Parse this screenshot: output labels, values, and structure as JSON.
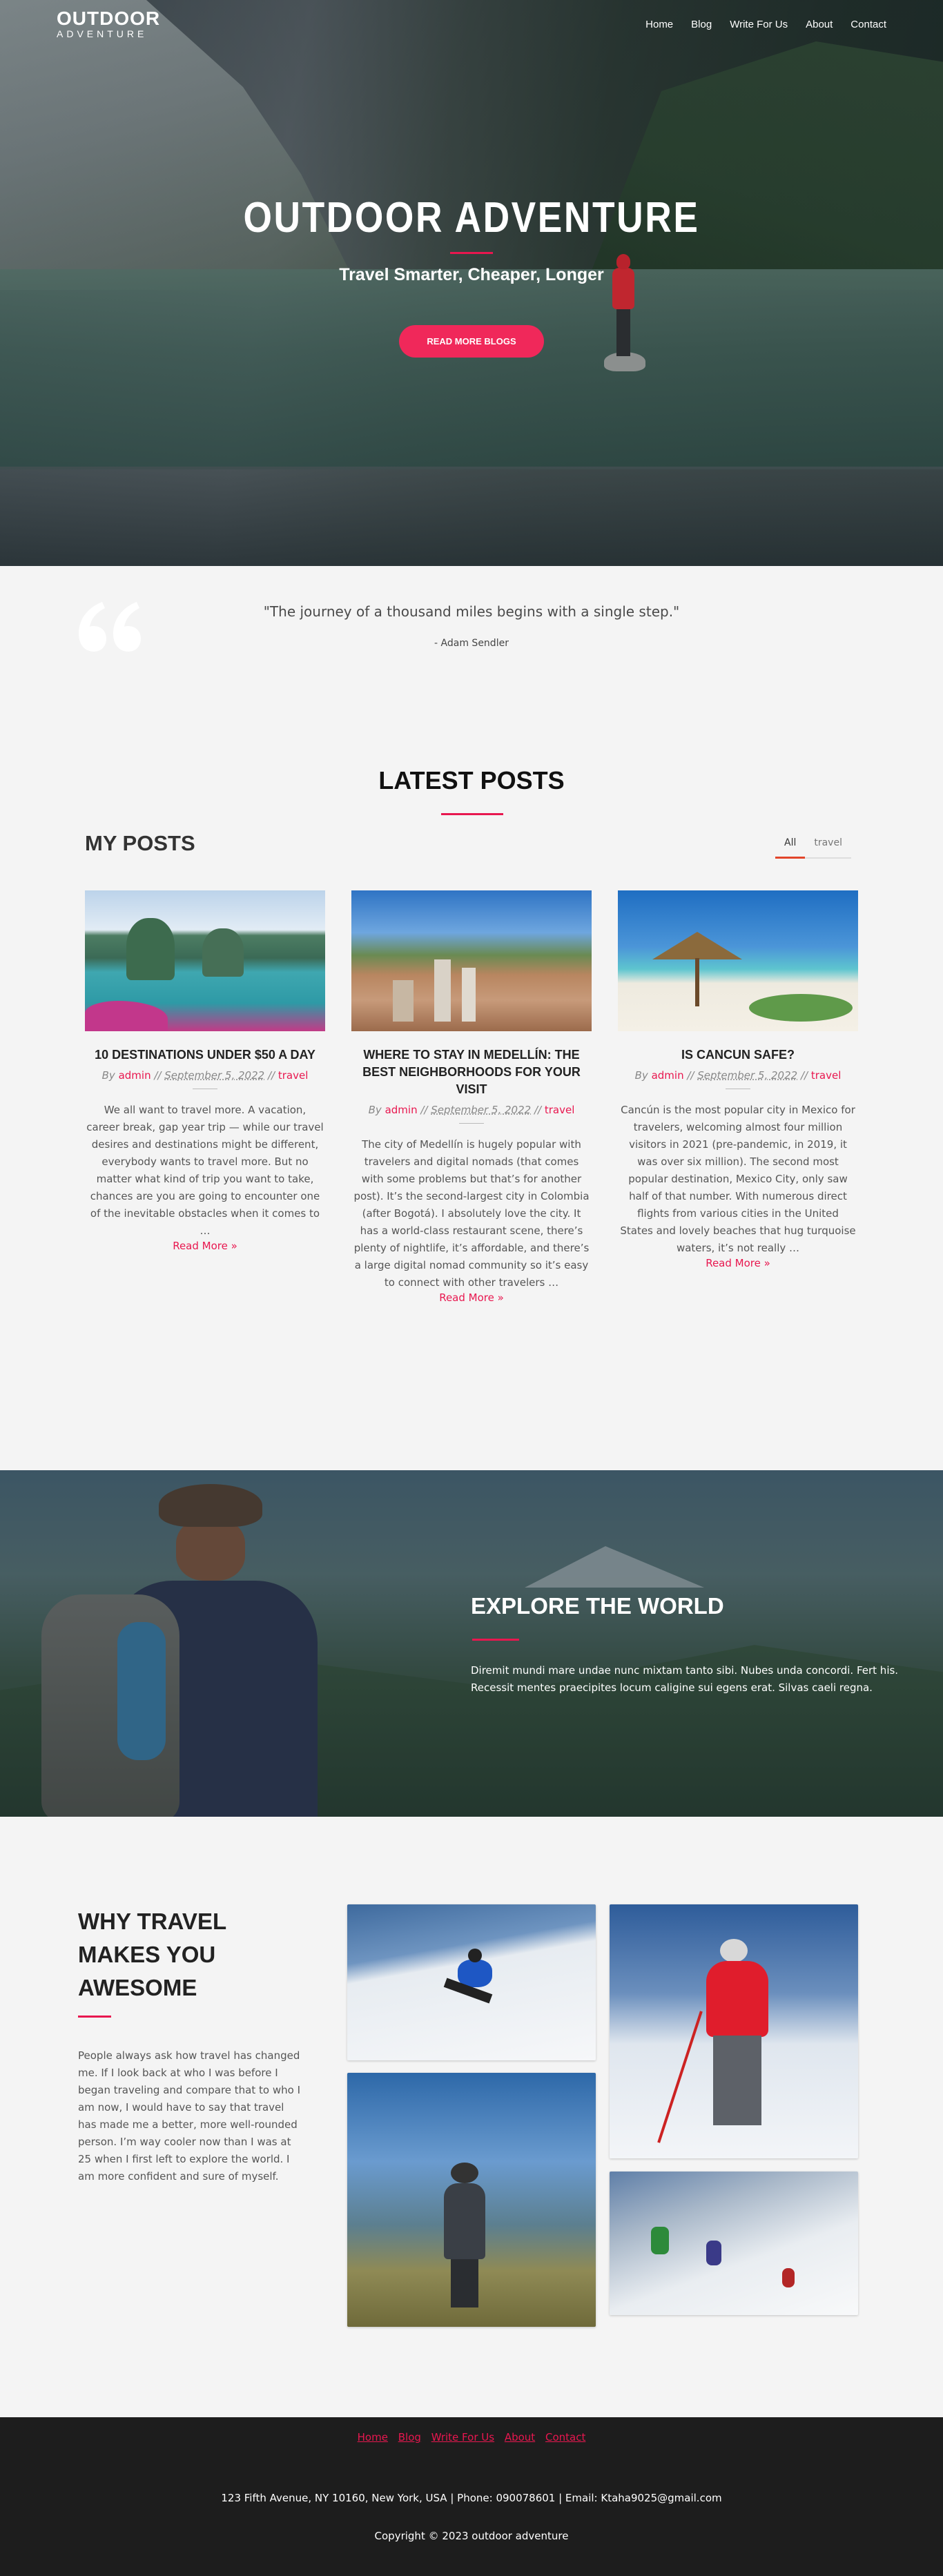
{
  "nav": {
    "logo_line1": "OUTDOOR",
    "logo_line2": "ADVENTURE",
    "items": [
      "Home",
      "Blog",
      "Write For Us",
      "About",
      "Contact"
    ]
  },
  "hero": {
    "title": "OUTDOOR ADVENTURE",
    "subtitle": "Travel Smarter, Cheaper, Longer",
    "button": "READ MORE BLOGS"
  },
  "quote": {
    "text": "\"The journey of a thousand miles begins with a single step.\"",
    "author": "- Adam Sendler"
  },
  "latest": {
    "title": "LATEST POSTS",
    "section_label": "MY POSTS",
    "filters": [
      "All",
      "travel"
    ]
  },
  "posts": [
    {
      "title": "10 DESTINATIONS UNDER $50 A DAY",
      "by": "By",
      "author": "admin",
      "date": "September 5, 2022",
      "category": "travel",
      "excerpt": "We all want to travel more. A vacation, career break, gap year trip — while our travel desires and destinations might be different, everybody wants to travel more. But no matter what kind of trip you want to take, chances are you are going to encounter one of the inevitable obstacles when it comes to …",
      "more": "Read More »"
    },
    {
      "title": "WHERE TO STAY IN MEDELLÍN: THE BEST NEIGHBORHOODS FOR YOUR VISIT",
      "by": "By",
      "author": "admin",
      "date": "September 5, 2022",
      "category": "travel",
      "excerpt": "The city of Medellín is hugely popular with travelers and digital nomads (that comes with some problems but that’s for another post). It’s the second-largest city in Colombia (after Bogotá). I absolutely love the city. It has a world-class restaurant scene, there’s plenty of nightlife, it’s affordable, and there’s a large digital nomad community so it’s easy to connect with other travelers …",
      "more": "Read More »"
    },
    {
      "title": "IS CANCUN SAFE?",
      "by": "By",
      "author": "admin",
      "date": "September 5, 2022",
      "category": "travel",
      "excerpt": "Cancún is the most popular city in Mexico for travelers, welcoming almost four million visitors in 2021 (pre-pandemic, in 2019, it was over six million). The second most popular destination, Mexico City, only saw half of that number. With numerous direct flights from various cities in the United States and lovely beaches that hug turquoise waters, it’s not really …",
      "more": "Read More »"
    }
  ],
  "explore": {
    "title": "EXPLORE THE WORLD",
    "text": "Diremit mundi mare undae nunc mixtam tanto sibi. Nubes unda concordi. Fert his. Recessit mentes praecipites locum caligine sui egens erat. Silvas caeli regna."
  },
  "why": {
    "title": "WHY TRAVEL MAKES YOU AWESOME",
    "text": "People always ask how travel has changed me. If I look back at who I was before I began traveling and compare that to who I am now, I would have to say that travel has made me a better, more well-rounded person. I’m way cooler now than I was at 25 when I first left to explore the world. I am more confident and sure of myself."
  },
  "footer": {
    "links": [
      "Home",
      "Blog",
      "Write For Us",
      "About",
      "Contact"
    ],
    "address": "123 Fifth Avenue, NY 10160, New York, USA | Phone: 090078601 | Email: Ktaha9025@gmail.com",
    "copyright": "Copyright © 2023 outdoor adventure"
  },
  "colors": {
    "accent": "#e8174f",
    "button": "#f0285a",
    "footer_bg": "#1d1d1d",
    "page_bg": "#f4f4f4"
  }
}
